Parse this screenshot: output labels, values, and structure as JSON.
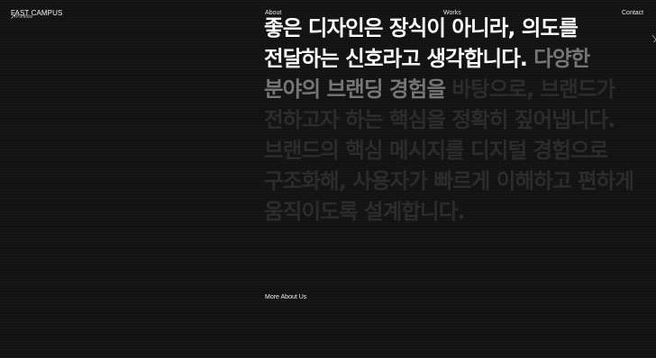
{
  "header": {
    "logo_text": "FAST CAMPUS",
    "logo_subtext": "Portfolio",
    "nav": {
      "about": "About",
      "works": "Works",
      "contact": "Contact"
    }
  },
  "main": {
    "headline": {
      "bright": "좋은 디자인은 장식이 아니라, 의도를 전달하는 신호라고 생각합니다.",
      "mid": " 다양한 분야의 브랜딩 경험을",
      "dim": " 바탕으로, 브랜드가 전하고자 하는 핵심을 정확히 짚어냅니다. 브랜드의 핵심 메시지를 디지털 경험으로 구조화해, 사용자가 빠르게 이해하고 편하게 움직이도록 설계합니다."
    },
    "more_link": "More About Us"
  },
  "colors": {
    "background": "#131313",
    "text_bright": "#ffffff",
    "text_mid": "#767676",
    "text_dim": "#2c2c2c"
  },
  "icons": {
    "logo_mark": "arrow-icon",
    "edge": "slash-icon"
  }
}
